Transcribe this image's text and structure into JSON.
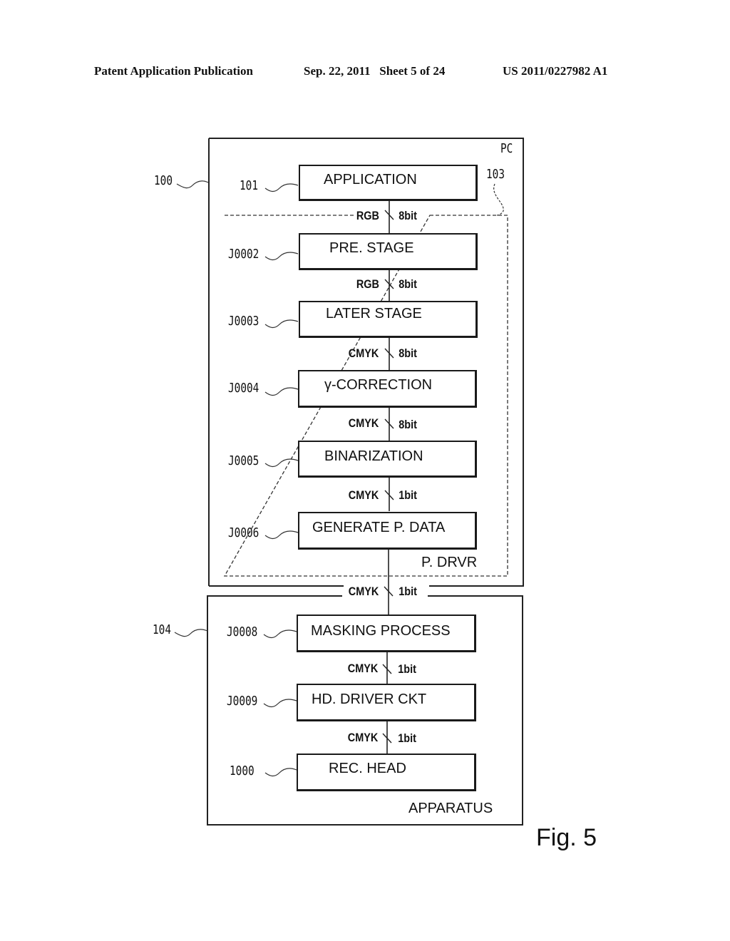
{
  "header": {
    "publication": "Patent Application Publication",
    "date_sheet": "Sep. 22, 2011   Sheet 5 of 24",
    "number": "US 2011/0227982 A1"
  },
  "figure_label": "Fig. 5",
  "groups": {
    "pc": {
      "label": "PC",
      "ref": "100"
    },
    "driver": {
      "label": "P. DRVR",
      "ref": "103"
    },
    "apparatus": {
      "label": "APPARATUS",
      "ref": "104"
    }
  },
  "blocks": [
    {
      "ref": "101",
      "label": "APPLICATION"
    },
    {
      "ref": "J0002",
      "label": "PRE. STAGE"
    },
    {
      "ref": "J0003",
      "label": "LATER STAGE"
    },
    {
      "ref": "J0004",
      "label": "γ-CORRECTION"
    },
    {
      "ref": "J0005",
      "label": "BINARIZATION"
    },
    {
      "ref": "J0006",
      "label": "GENERATE P. DATA"
    },
    {
      "ref": "J0008",
      "label": "MASKING PROCESS"
    },
    {
      "ref": "J0009",
      "label": "HD. DRIVER CKT"
    },
    {
      "ref": "1000",
      "label": "REC. HEAD"
    }
  ],
  "signals": [
    {
      "format": "RGB",
      "depth": "8bit"
    },
    {
      "format": "RGB",
      "depth": "8bit"
    },
    {
      "format": "CMYK",
      "depth": "8bit"
    },
    {
      "format": "CMYK",
      "depth": "8bit"
    },
    {
      "format": "CMYK",
      "depth": "1bit"
    },
    {
      "format": "CMYK",
      "depth": "1bit"
    },
    {
      "format": "CMYK",
      "depth": "1bit"
    },
    {
      "format": "CMYK",
      "depth": "1bit"
    }
  ]
}
